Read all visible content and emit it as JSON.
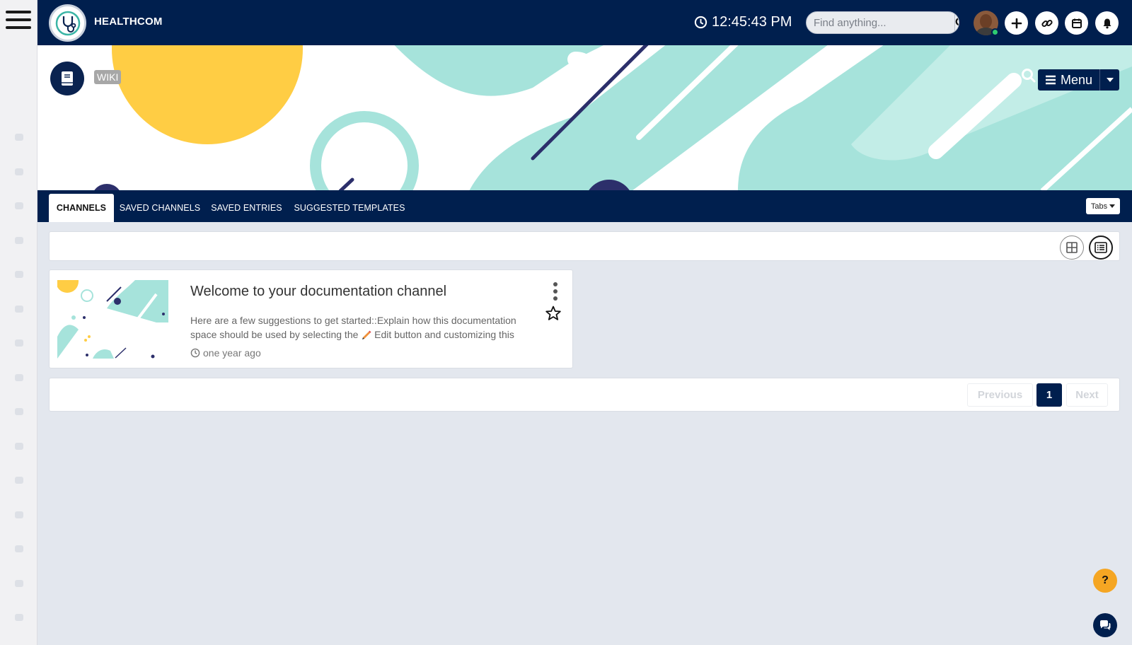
{
  "app": {
    "brand": "HEALTHCOM"
  },
  "header": {
    "clock": "12:45:43 PM",
    "search": {
      "placeholder": "Find anything..."
    }
  },
  "space": {
    "label": "WIKI",
    "menu_label": "Menu"
  },
  "tabs": [
    {
      "label": "CHANNELS",
      "active": true
    },
    {
      "label": "SAVED CHANNELS",
      "active": false
    },
    {
      "label": "SAVED ENTRIES",
      "active": false
    },
    {
      "label": "SUGGESTED TEMPLATES",
      "active": false
    }
  ],
  "tabs_dropdown": "Tabs",
  "channel": {
    "title": "Welcome to your documentation channel",
    "description_1": "Here are a few suggestions to get started::Explain how this documentation",
    "description_2": "space should be used by selecting the",
    "description_3": "Edit button and customizing this",
    "time": "one year ago"
  },
  "pagination": {
    "previous": "Previous",
    "current": "1",
    "next": "Next"
  },
  "help_label": "?",
  "colors": {
    "navy": "#001f4e",
    "teal": "#a6e3db",
    "yellow": "#ffcd44",
    "help": "#f5a623"
  }
}
